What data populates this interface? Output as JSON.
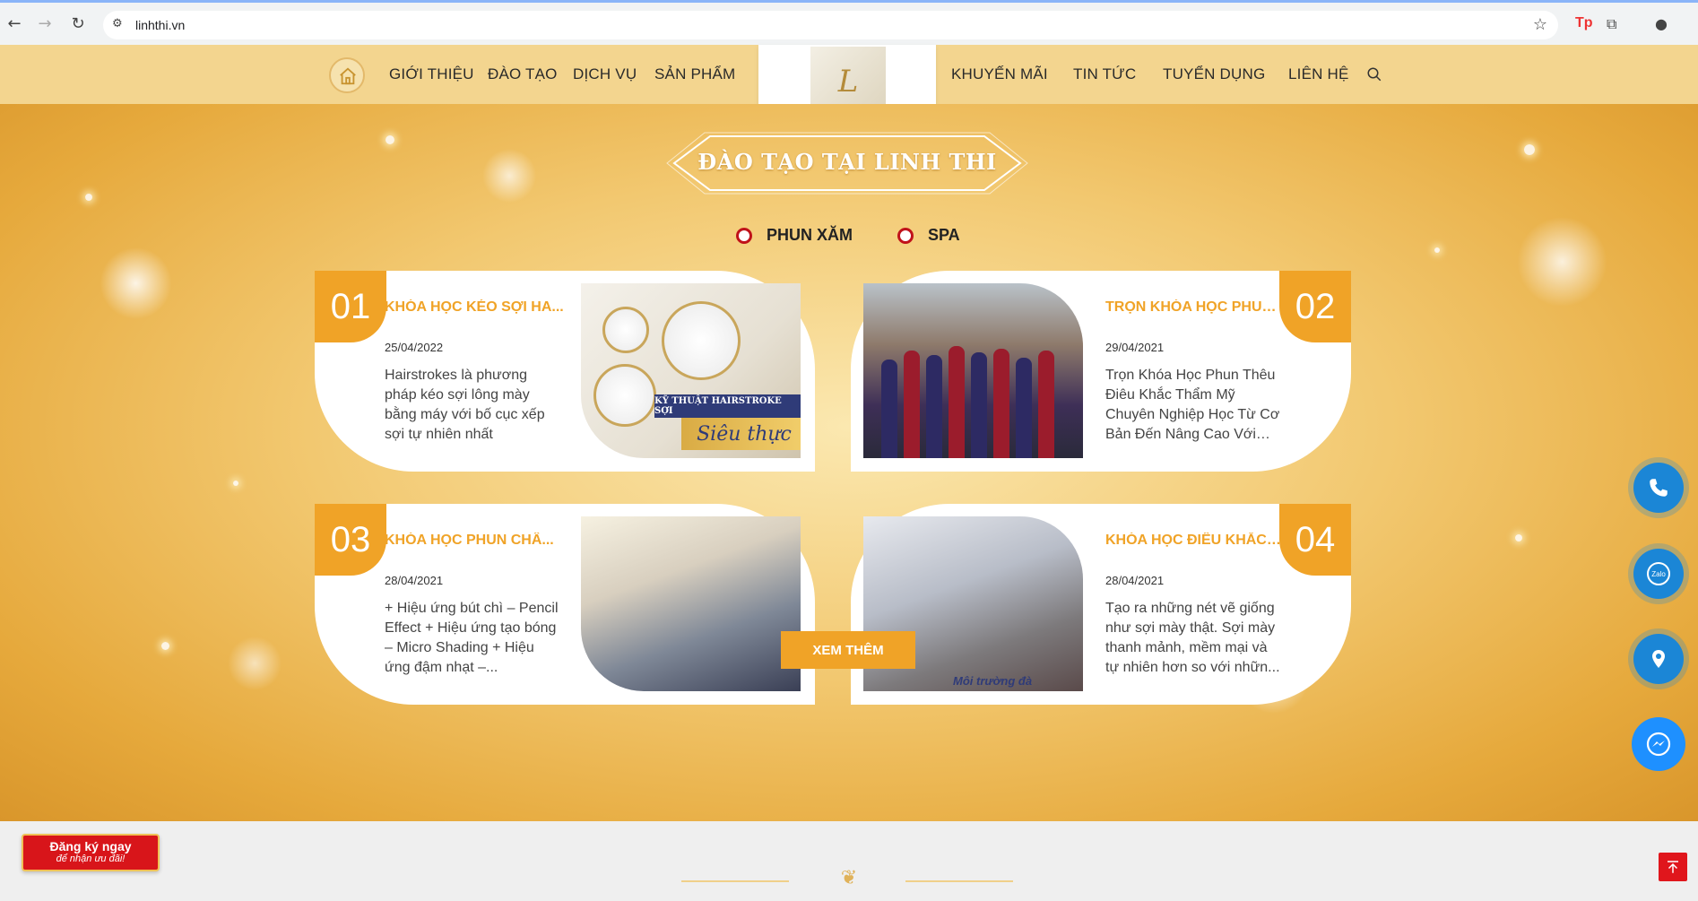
{
  "browser": {
    "url": "linhthi.vn"
  },
  "header": {
    "nav_left": [
      "GIỚI THIỆU",
      "ĐÀO TẠO",
      "DỊCH VỤ",
      "SẢN PHẨM"
    ],
    "nav_right": [
      "KHUYẾN MÃI",
      "TIN TỨC",
      "TUYỂN DỤNG",
      "LIÊN HỆ"
    ],
    "logo_text": "Linh Thi",
    "accent": "#f0a327"
  },
  "section": {
    "title": "ĐÀO TẠO TẠI LINH THI",
    "tabs": [
      "PHUN XĂM",
      "SPA"
    ],
    "more_label": "XEM THÊM"
  },
  "courses": [
    {
      "num": "01",
      "title": "KHÓA HỌC KÉO SỢI HA...",
      "date": "25/04/2022",
      "desc": "Hairstrokes là phương pháp kéo sợi lông mày bằng máy với bố cục xếp sợi tự nhiên nhất",
      "banner_top": "KỸ THUẬT HAIRSTROKE SỢI",
      "banner_bottom": "Siêu thực"
    },
    {
      "num": "02",
      "title": "TRỌN KHÓA HỌC PHUN ...",
      "date": "29/04/2021",
      "desc": "Trọn Khóa Học Phun Thêu Điêu Khắc Thẩm Mỹ Chuyên Nghiệp Học Từ Cơ Bản Đến Nâng Cao Với Ti..."
    },
    {
      "num": "03",
      "title": "KHÓA HỌC PHUN CHÂ...",
      "date": "28/04/2021",
      "desc": "+ Hiệu ứng bút chì – Pencil Effect + Hiệu ứng tạo bóng – Micro Shading + Hiệu ứng đậm nhạt –..."
    },
    {
      "num": "04",
      "title": "KHÓA HỌC ĐIÊU KHẮC C...",
      "date": "28/04/2021",
      "desc": "Tạo ra những nét vẽ giống như sợi mày thật. Sợi mày thanh mảnh, mềm mại và tự nhiên hơn so với nhữn...",
      "caption": "Môi trường đà"
    }
  ],
  "signup": {
    "line1": "Đăng ký ngay",
    "line2": "để nhận ưu đãi!"
  },
  "floating": [
    "phone-icon",
    "zalo-icon",
    "location-icon",
    "messenger-icon"
  ]
}
